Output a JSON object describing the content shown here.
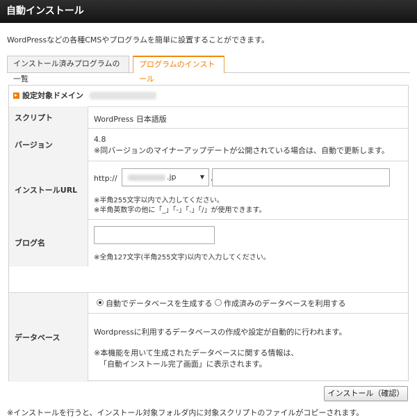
{
  "header": {
    "title": "自動インストール"
  },
  "intro": "WordPressなどの各種CMSやプログラムを簡単に設置することができます。",
  "tabs": [
    {
      "label": "インストール済みプログラムの一覧",
      "active": false
    },
    {
      "label": "プログラムのインストール",
      "active": true
    }
  ],
  "domain": {
    "label": "設定対象ドメイン"
  },
  "rows": {
    "script": {
      "label": "スクリプト",
      "value": "WordPress 日本語版"
    },
    "version": {
      "label": "バージョン",
      "value": "4.8",
      "note": "※同バージョンのマイナーアップデートが公開されている場合は、自動で更新します。"
    },
    "install_url": {
      "label": "インストールURL",
      "prefix": "http://",
      "domain_suffix": ".jp",
      "slash": "/",
      "path_value": "",
      "note1": "※半角255文字以内で入力してください。",
      "note2": "※半角英数字の他に「_」「-」「.」「/」が使用できます。"
    },
    "blog_name": {
      "label": "ブログ名",
      "value": "",
      "note": "※全角127文字(半角255文字)以内で入力してください。"
    },
    "database": {
      "label": "データベース",
      "option_auto": "自動でデータベースを生成する",
      "option_existing": "作成済みのデータベースを利用する",
      "selected": "auto",
      "desc": "Wordpressに利用するデータベースの作成や設定が自動的に行われます。",
      "note1": "※本機能を用いて生成されたデータベースに関する情報は、",
      "note2": "「自動インストール完了画面」に表示されます。"
    }
  },
  "confirm_button": "インストール（確認）",
  "footer_note": "※インストールを行うと、インストール対象フォルダ内に対象スクリプトのファイルがコピーされます。",
  "colors": {
    "accent": "#f07d00",
    "header_bg": "#1e1e1e",
    "label_bg": "#f3f3f3"
  }
}
